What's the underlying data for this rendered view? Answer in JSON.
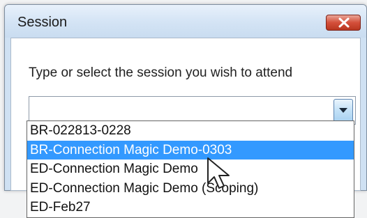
{
  "dialog": {
    "title": "Session",
    "close_icon": "close-x-icon",
    "prompt": "Type or select the session you wish to attend",
    "combo": {
      "value": "",
      "dropdown_icon": "chevron-down-icon",
      "options": [
        {
          "label": "BR-022813-0228",
          "selected": false
        },
        {
          "label": "BR-Connection Magic Demo-0303",
          "selected": true
        },
        {
          "label": "ED-Connection Magic Demo",
          "selected": false
        },
        {
          "label": "ED-Connection Magic Demo (Scoping)",
          "selected": false
        },
        {
          "label": "ED-Feb27",
          "selected": false
        }
      ]
    }
  },
  "colors": {
    "selection": "#3399ff",
    "close_button": "#d44f3a",
    "title_bar": "#d4e4f5"
  }
}
